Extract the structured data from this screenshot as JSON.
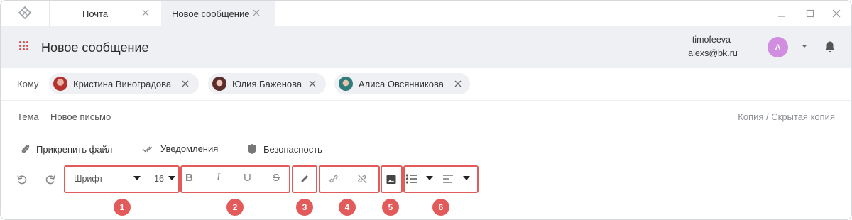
{
  "tabs": [
    {
      "label": "Почта"
    },
    {
      "label": "Новое сообщение"
    }
  ],
  "header": {
    "title": "Новое сообщение",
    "user_email_line1": "timofeeva-",
    "user_email_line2": "alexs@bk.ru",
    "avatar_letter": "A"
  },
  "to": {
    "label": "Кому",
    "recipients": [
      {
        "name": "Кристина Виноградова"
      },
      {
        "name": "Юлия Баженова"
      },
      {
        "name": "Алиса Овсянникова"
      }
    ]
  },
  "subject": {
    "label": "Тема",
    "value": "Новое письмо",
    "cc_link": "Копия / Скрытая копия"
  },
  "options": {
    "attach": "Прикрепить файл",
    "notifications": "Уведомления",
    "security": "Безопасность"
  },
  "toolbar": {
    "font": "Шрифт",
    "size": "16",
    "badges": [
      "1",
      "2",
      "3",
      "4",
      "5",
      "6"
    ]
  },
  "colors": {
    "accent": "#e35a5a",
    "avatar": "#d18ee0",
    "header_bg": "#eef0f4"
  }
}
